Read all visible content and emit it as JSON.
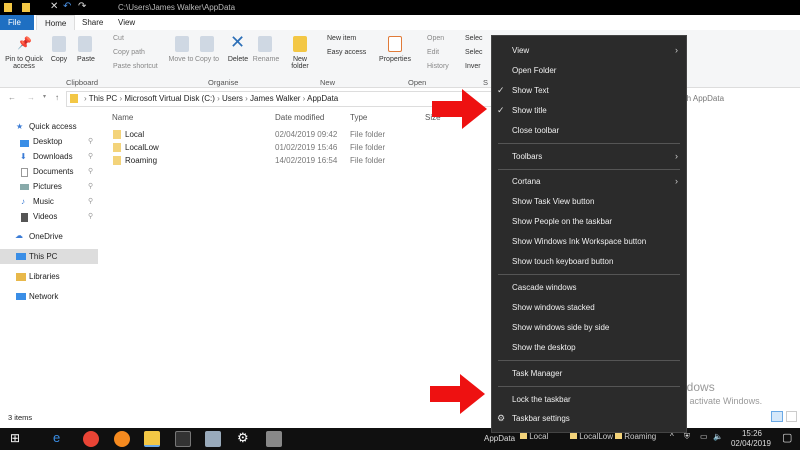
{
  "window": {
    "title": "C:\\Users\\James Walker\\AppData"
  },
  "tabs": [
    "File",
    "Home",
    "Share",
    "View"
  ],
  "ribbon": {
    "clipboard": {
      "pin": "Pin to Quick access",
      "copy": "Copy",
      "paste": "Paste",
      "cut": "Cut",
      "copy_path": "Copy path",
      "paste_shortcut": "Paste shortcut",
      "label": "Clipboard"
    },
    "organise": {
      "move_to": "Move to",
      "copy_to": "Copy to",
      "delete": "Delete",
      "rename": "Rename",
      "label": "Organise"
    },
    "new": {
      "new_folder": "New folder",
      "new_item": "New item",
      "easy_access": "Easy access",
      "label": "New"
    },
    "open": {
      "properties": "Properties",
      "open": "Open",
      "edit": "Edit",
      "history": "History",
      "label": "Open"
    },
    "select": {
      "select_all": "Selec",
      "select_none": "Selec",
      "invert": "Inver",
      "label": "S"
    }
  },
  "address": {
    "crumbs": [
      "This PC",
      "Microsoft Virtual Disk (C:)",
      "Users",
      "James Walker",
      "AppData"
    ],
    "search_placeholder": "rch AppData"
  },
  "nav": {
    "items": [
      "Quick access",
      "Desktop",
      "Downloads",
      "Documents",
      "Pictures",
      "Music",
      "Videos",
      "OneDrive",
      "This PC",
      "Libraries",
      "Network"
    ]
  },
  "columns": [
    "Name",
    "Date modified",
    "Type",
    "Size"
  ],
  "files": [
    {
      "name": "Local",
      "date": "02/04/2019 09:42",
      "type": "File folder"
    },
    {
      "name": "LocalLow",
      "date": "01/02/2019 15:46",
      "type": "File folder"
    },
    {
      "name": "Roaming",
      "date": "14/02/2019 16:54",
      "type": "File folder"
    }
  ],
  "status": "3 items",
  "menu": {
    "items": [
      "View",
      "Open Folder",
      "Show Text",
      "Show title",
      "Close toolbar",
      "Toolbars",
      "Cortana",
      "Show Task View button",
      "Show People on the taskbar",
      "Show Windows Ink Workspace button",
      "Show touch keyboard button",
      "Cascade windows",
      "Show windows stacked",
      "Show windows side by side",
      "Show the desktop",
      "Task Manager",
      "Lock the taskbar",
      "Taskbar settings"
    ]
  },
  "watermark": {
    "title": "Activate Windows",
    "sub": "Go to Settings to activate Windows."
  },
  "taskbar": {
    "toolbar_label": "AppData",
    "items": [
      "Local",
      "LocalLow",
      "Roaming"
    ],
    "time": "15:26",
    "date": "02/04/2019"
  },
  "colors": {
    "accent": "#1e6fc2",
    "arrow": "#ee1111",
    "menu_bg": "#2b2b2b"
  }
}
